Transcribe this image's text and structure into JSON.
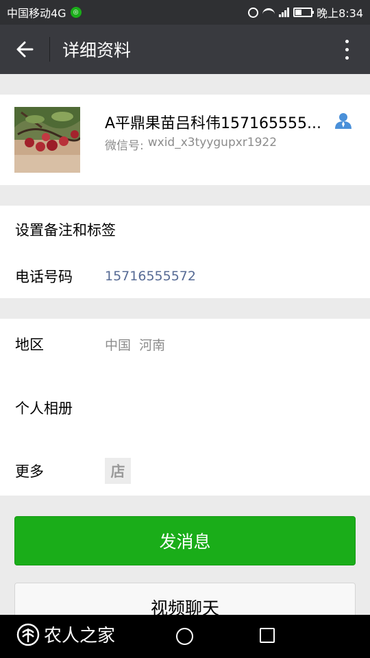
{
  "status_bar": {
    "carrier": "中国移动4G",
    "time": "晚上8:34",
    "signal_label": "4G",
    "icons": [
      "carrier-badge-icon",
      "alarm-icon",
      "wifi-icon",
      "signal-icon",
      "battery-icon"
    ]
  },
  "header": {
    "title": "详细资料",
    "back_icon": "arrow-left-icon",
    "more_icon": "more-vertical-icon"
  },
  "profile": {
    "name": "A平鼎果苗吕科伟157165555...",
    "wechat_id_label": "微信号:",
    "wechat_id": "wxid_x3tyygupxr1922",
    "badge_icon": "contact-person-icon",
    "colors": {
      "badge": "#4a90d9"
    }
  },
  "info": {
    "remark_label": "设置备注和标签",
    "phone_label": "电话号码",
    "phone_value": "15716555572",
    "region_label": "地区",
    "region_country": "中国",
    "region_province": "河南",
    "album_label": "个人相册",
    "more_label": "更多",
    "shop_icon_text": "店"
  },
  "actions": {
    "send_message": "发消息",
    "video_chat": "视频聊天",
    "colors": {
      "primary": "#1aad19"
    }
  },
  "nav_bar": {
    "watermark": "农人之家",
    "icons": [
      "home-circle-icon",
      "recents-square-icon"
    ]
  },
  "colors": {
    "link": "#576b95",
    "header_bg": "#393a3f",
    "page_bg": "#ebebeb"
  }
}
